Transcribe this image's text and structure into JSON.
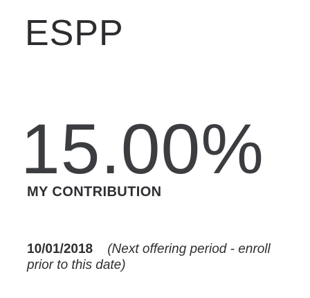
{
  "card": {
    "title": "ESPP",
    "contribution": {
      "value": "15.00%",
      "label": "MY CONTRIBUTION"
    },
    "offering": {
      "date": "10/01/2018",
      "note": "(Next offering period - enroll prior to this date)"
    }
  }
}
